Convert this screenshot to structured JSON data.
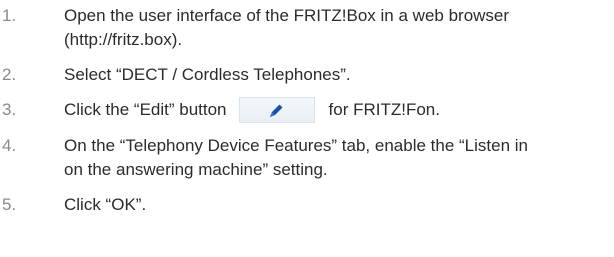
{
  "steps": [
    {
      "number": "1.",
      "line1": "Open the user interface of the FRITZ!Box in a web browser",
      "line2": "(http://fritz.box)."
    },
    {
      "number": "2.",
      "text": "Select “DECT / Cordless Telephones”."
    },
    {
      "number": "3.",
      "before": "Click the “Edit” button",
      "button_icon": "pencil-icon",
      "after": "for FRITZ!Fon."
    },
    {
      "number": "4.",
      "line1": "On the “Telephony Device Features” tab, enable the “Listen in",
      "line2": "on the answering machine” setting."
    },
    {
      "number": "5.",
      "text": "Click “OK”."
    }
  ],
  "colors": {
    "text": "#2b2b2b",
    "number": "#8a8a8a",
    "button_bg": "#eef3f7",
    "pencil": "#1f4fa0"
  }
}
